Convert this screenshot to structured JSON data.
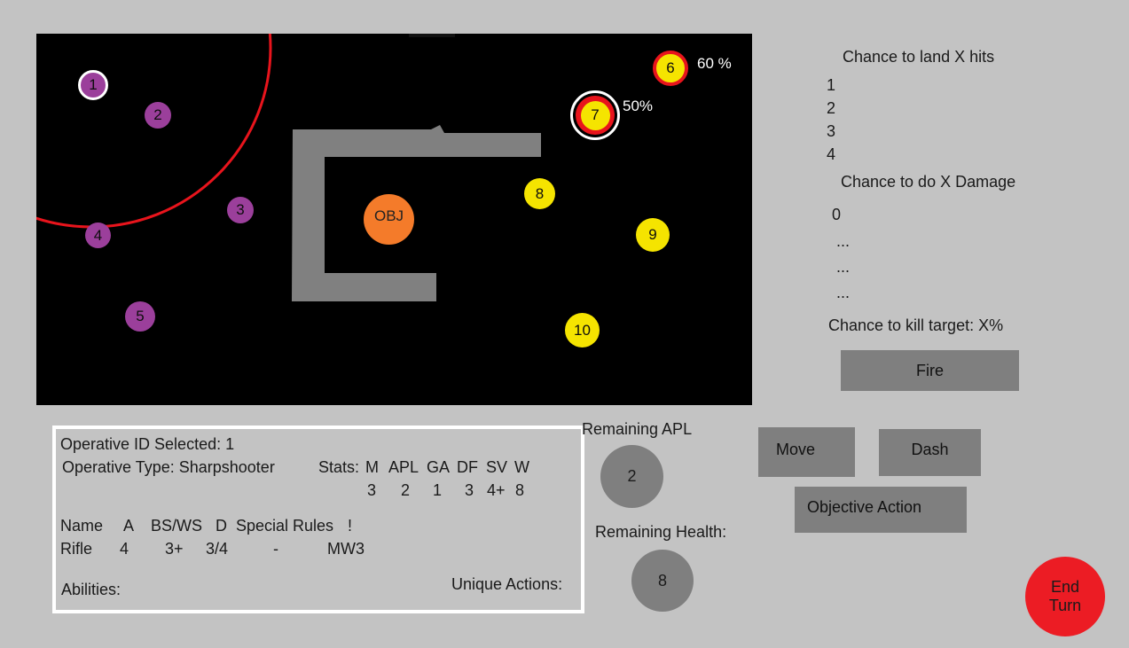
{
  "board": {
    "objective_label": "OBJ",
    "friendly": [
      {
        "id": "1",
        "selected": true
      },
      {
        "id": "2"
      },
      {
        "id": "3"
      },
      {
        "id": "4"
      },
      {
        "id": "5"
      }
    ],
    "enemy": [
      {
        "id": "6",
        "targeted": true,
        "hit_chance": "60 %"
      },
      {
        "id": "7",
        "targeted": true,
        "selected": true,
        "hit_chance": "50%"
      },
      {
        "id": "8"
      },
      {
        "id": "9"
      },
      {
        "id": "10"
      }
    ],
    "colors": {
      "friendly": "#9b3f9b",
      "enemy": "#f5e400",
      "objective": "#f47b2a",
      "range_ring": "#e8141c",
      "wall": "#808080"
    }
  },
  "shot_panel": {
    "hits_title": "Chance to land X hits",
    "hits": [
      "1",
      "2",
      "3",
      "4"
    ],
    "damage_title": "Chance to do X Damage",
    "damage": [
      "0",
      "...",
      "...",
      "..."
    ],
    "kill_chance": "Chance to kill target: X%",
    "fire_label": "Fire"
  },
  "operative": {
    "id_line": "Operative ID Selected: 1",
    "type_line": "Operative Type: Sharpshooter",
    "stats_label": "Stats:",
    "stat_headers": [
      "M",
      "APL",
      "GA",
      "DF",
      "SV",
      "W"
    ],
    "stat_values": [
      "3",
      "2",
      "1",
      "3",
      "4+",
      "8"
    ],
    "weapon_headers": [
      "Name",
      "A",
      "BS/WS",
      "D",
      "Special Rules",
      "!"
    ],
    "weapon_row": [
      "Rifle",
      "4",
      "3+",
      "3/4",
      "-",
      "MW3"
    ],
    "abilities_label": "Abilities:",
    "unique_actions_label": "Unique Actions:"
  },
  "status": {
    "apl_label": "Remaining APL",
    "apl_value": "2",
    "health_label": "Remaining Health:",
    "health_value": "8"
  },
  "actions": {
    "move": "Move",
    "dash": "Dash",
    "objective": "Objective Action",
    "end_turn_line1": "End",
    "end_turn_line2": "Turn",
    "end_turn_color": "#ec1c24"
  }
}
